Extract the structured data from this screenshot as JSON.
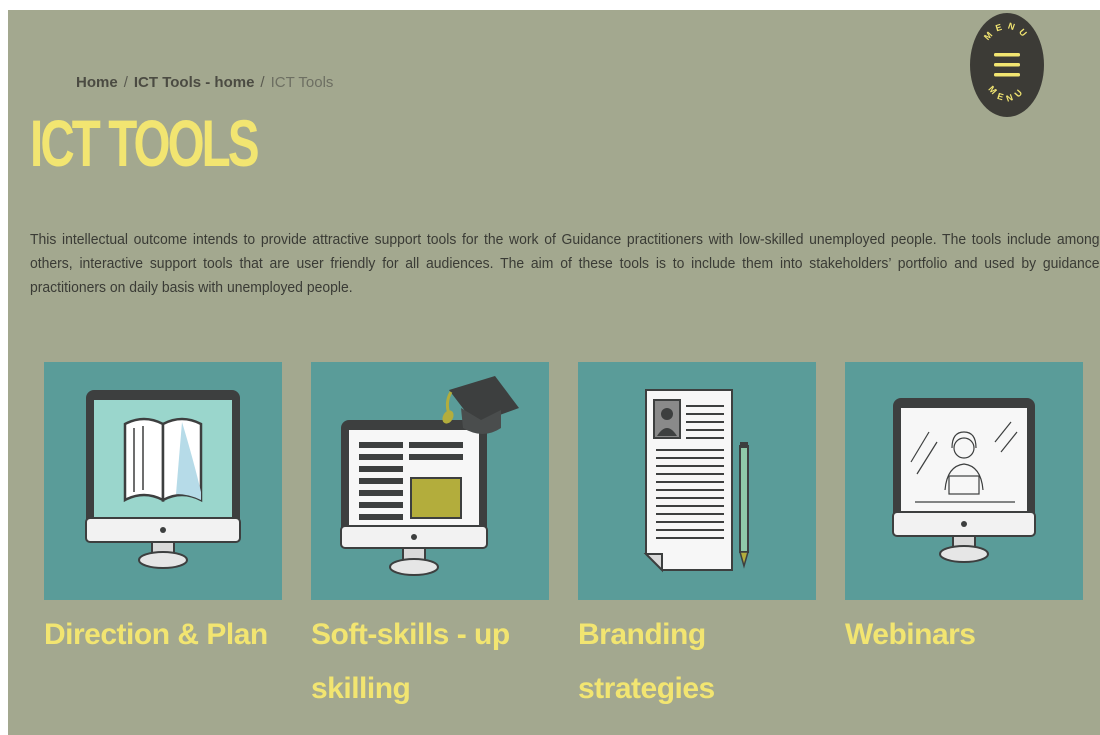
{
  "breadcrumb": {
    "home": "Home",
    "separator": "/",
    "parent": "ICT Tools - home",
    "current": "ICT Tools"
  },
  "menu": {
    "label_top": "MENU",
    "label_bottom": "MENU"
  },
  "page": {
    "title": "ICT TOOLS",
    "intro": "This intellectual outcome intends to provide attractive support tools for the work of Guidance practitioners with low-skilled unemployed people. The tools include among others, interactive support tools that are user friendly for all audiences. The aim of these tools is to include them into stakeholders’ portfolio and used by guidance practitioners on daily basis with unemployed people."
  },
  "tools": [
    {
      "label": "Direction & Plan",
      "icon": "monitor-book-icon"
    },
    {
      "label": "Soft-skills - up skilling",
      "icon": "monitor-graduation-cap-icon"
    },
    {
      "label": "Branding strategies",
      "icon": "resume-pencil-icon"
    },
    {
      "label": "Webinars",
      "icon": "monitor-webinar-icon"
    }
  ],
  "colors": {
    "background": "#a3a88f",
    "accent": "#f2e571",
    "tile": "#5a9c99",
    "text": "#3a3b35"
  }
}
